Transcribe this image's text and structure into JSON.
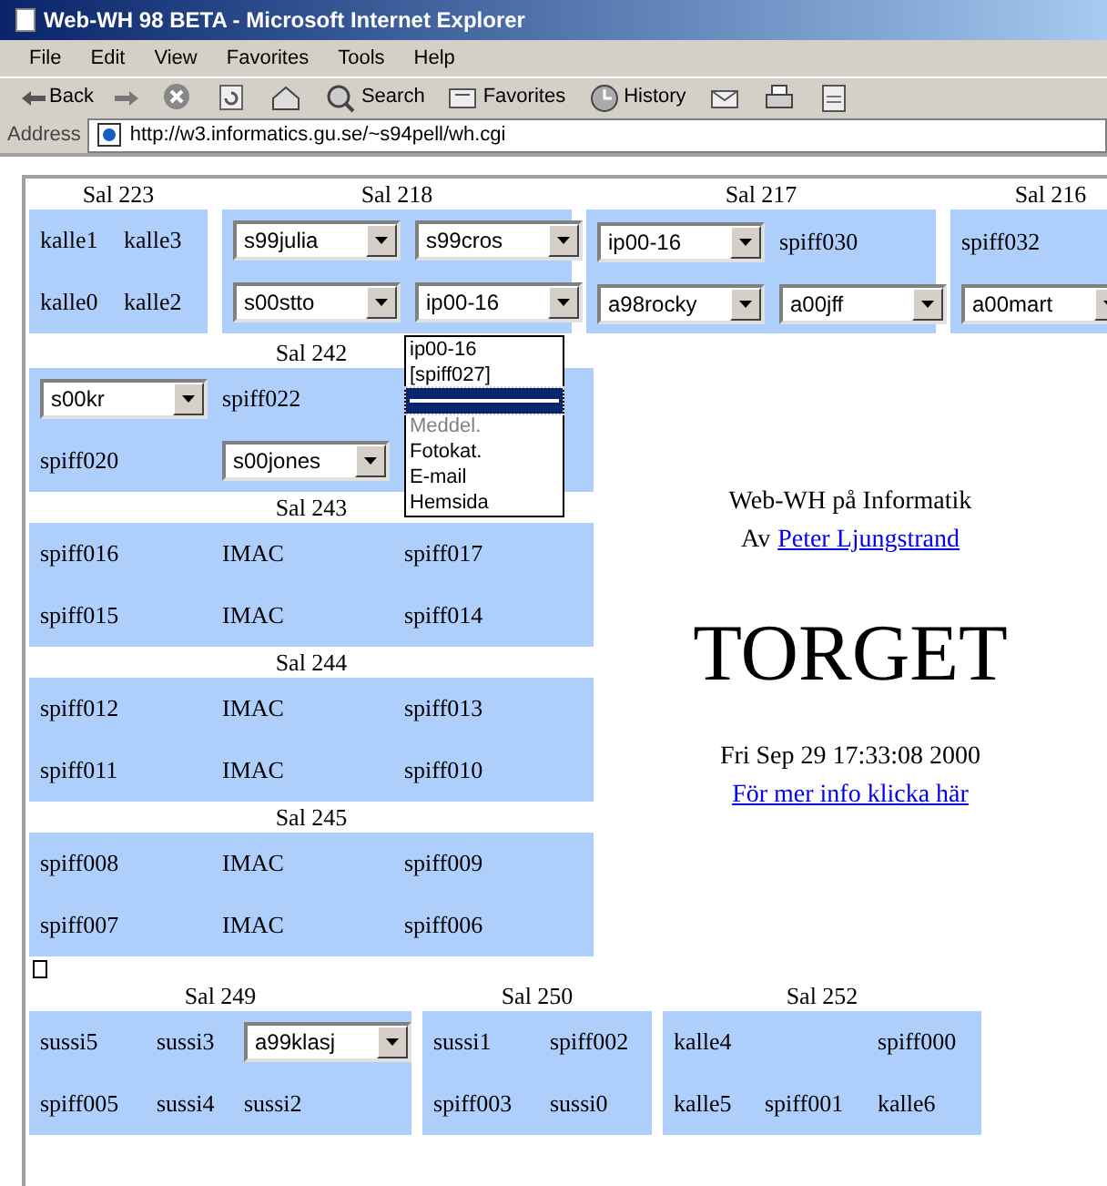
{
  "window": {
    "title": "Web-WH 98 BETA - Microsoft Internet Explorer"
  },
  "menu": [
    "File",
    "Edit",
    "View",
    "Favorites",
    "Tools",
    "Help"
  ],
  "toolbar": [
    {
      "kind": "back",
      "label": "Back"
    },
    {
      "kind": "forward"
    },
    {
      "kind": "stop"
    },
    {
      "kind": "refresh"
    },
    {
      "kind": "home"
    },
    {
      "kind": "search",
      "label": "Search"
    },
    {
      "kind": "favorites",
      "label": "Favorites"
    },
    {
      "kind": "history",
      "label": "History"
    },
    {
      "kind": "mail"
    },
    {
      "kind": "print"
    },
    {
      "kind": "edit"
    }
  ],
  "address": {
    "label": "Address",
    "value": "http://w3.informatics.gu.se/~s94pell/wh.cgi"
  },
  "top_rooms": [
    {
      "title": "Sal 223",
      "rows": [
        [
          {
            "kind": "text",
            "value": "kalle1"
          },
          {
            "kind": "text",
            "value": "kalle3"
          }
        ],
        [
          {
            "kind": "text",
            "value": "kalle0"
          },
          {
            "kind": "text",
            "value": "kalle2"
          }
        ]
      ]
    },
    {
      "title": "Sal 218",
      "rows": [
        [
          {
            "kind": "select",
            "value": "s99julia"
          },
          {
            "kind": "select",
            "value": "s99cros"
          }
        ],
        [
          {
            "kind": "select",
            "value": "s00stto"
          },
          {
            "kind": "select",
            "value": "ip00-16"
          }
        ]
      ]
    },
    {
      "title": "Sal 217",
      "rows": [
        [
          {
            "kind": "select",
            "value": "ip00-16"
          },
          {
            "kind": "text",
            "value": "spiff030"
          }
        ],
        [
          {
            "kind": "select",
            "value": "a98rocky"
          },
          {
            "kind": "select",
            "value": "a00jff"
          }
        ]
      ]
    },
    {
      "title": "Sal 216",
      "rows": [
        [
          {
            "kind": "text",
            "value": "spiff032"
          }
        ],
        [
          {
            "kind": "select",
            "value": "a00mart"
          }
        ]
      ]
    }
  ],
  "left_rooms": [
    {
      "title": "Sal 242",
      "rows": [
        [
          {
            "kind": "select",
            "value": "s00kr"
          },
          {
            "kind": "text",
            "value": "spiff022"
          }
        ],
        [
          {
            "kind": "text",
            "value": "spiff020"
          },
          {
            "kind": "select",
            "value": "s00jones"
          }
        ]
      ]
    },
    {
      "title": "Sal 243",
      "rows": [
        [
          {
            "kind": "text",
            "value": "spiff016"
          },
          {
            "kind": "text",
            "value": "IMAC"
          },
          {
            "kind": "text",
            "value": "spiff017"
          }
        ],
        [
          {
            "kind": "text",
            "value": "spiff015"
          },
          {
            "kind": "text",
            "value": "IMAC"
          },
          {
            "kind": "text",
            "value": "spiff014"
          }
        ]
      ]
    },
    {
      "title": "Sal 244",
      "rows": [
        [
          {
            "kind": "text",
            "value": "spiff012"
          },
          {
            "kind": "text",
            "value": "IMAC"
          },
          {
            "kind": "text",
            "value": "spiff013"
          }
        ],
        [
          {
            "kind": "text",
            "value": "spiff011"
          },
          {
            "kind": "text",
            "value": "IMAC"
          },
          {
            "kind": "text",
            "value": "spiff010"
          }
        ]
      ]
    },
    {
      "title": "Sal 245",
      "rows": [
        [
          {
            "kind": "text",
            "value": "spiff008"
          },
          {
            "kind": "text",
            "value": "IMAC"
          },
          {
            "kind": "text",
            "value": "spiff009"
          }
        ],
        [
          {
            "kind": "text",
            "value": "spiff007"
          },
          {
            "kind": "text",
            "value": "IMAC"
          },
          {
            "kind": "text",
            "value": "spiff006"
          }
        ]
      ]
    }
  ],
  "info": {
    "line1": "Web-WH på Informatik",
    "by": "Av",
    "author_link": "Peter Ljungstrand",
    "heading": "TORGET",
    "timestamp": "Fri Sep 29 17:33:08 2000",
    "more_link": "För mer info klicka här"
  },
  "bottom_rooms": [
    {
      "title": "Sal 249",
      "rows": [
        [
          {
            "kind": "text",
            "value": "sussi5"
          },
          {
            "kind": "text",
            "value": "sussi3"
          },
          {
            "kind": "select",
            "value": "a99klasj"
          }
        ],
        [
          {
            "kind": "text",
            "value": "spiff005"
          },
          {
            "kind": "text",
            "value": "sussi4"
          },
          {
            "kind": "text",
            "value": "sussi2"
          }
        ]
      ]
    },
    {
      "title": "Sal 250",
      "rows": [
        [
          {
            "kind": "text",
            "value": "sussi1"
          },
          {
            "kind": "text",
            "value": "spiff002"
          }
        ],
        [
          {
            "kind": "text",
            "value": "spiff003"
          },
          {
            "kind": "text",
            "value": "sussi0"
          }
        ]
      ]
    },
    {
      "title": "Sal 252",
      "rows": [
        [
          {
            "kind": "text",
            "value": "kalle4"
          },
          {
            "kind": "empty"
          },
          {
            "kind": "text",
            "value": "spiff000"
          }
        ],
        [
          {
            "kind": "text",
            "value": "kalle5"
          },
          {
            "kind": "text",
            "value": "spiff001"
          },
          {
            "kind": "text",
            "value": "kalle6"
          }
        ]
      ]
    }
  ],
  "dropdown": {
    "options": [
      {
        "kind": "option",
        "label": "ip00-16",
        "selected": false,
        "disabled": false
      },
      {
        "kind": "option",
        "label": "[spiff027]",
        "selected": false,
        "disabled": false
      },
      {
        "kind": "separator",
        "selected": true,
        "disabled": false
      },
      {
        "kind": "option",
        "label": "Meddel.",
        "selected": false,
        "disabled": true
      },
      {
        "kind": "option",
        "label": "Fotokat.",
        "selected": false,
        "disabled": false
      },
      {
        "kind": "option",
        "label": "E-mail",
        "selected": false,
        "disabled": false
      },
      {
        "kind": "option",
        "label": "Hemsida",
        "selected": false,
        "disabled": false
      }
    ]
  }
}
